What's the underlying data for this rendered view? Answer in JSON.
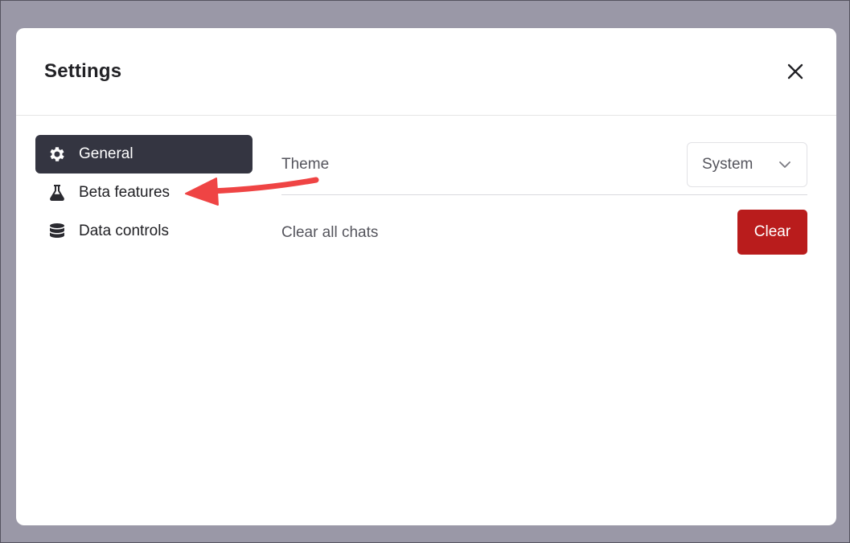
{
  "dialog": {
    "title": "Settings",
    "close_icon": "close-icon"
  },
  "nav": {
    "items": [
      {
        "label": "General",
        "icon": "gear-icon",
        "active": true
      },
      {
        "label": "Beta features",
        "icon": "flask-icon",
        "active": false
      },
      {
        "label": "Data controls",
        "icon": "database-icon",
        "active": false
      }
    ]
  },
  "settings": {
    "theme": {
      "label": "Theme",
      "value": "System",
      "icon": "chevron-down-icon"
    },
    "clear_chats": {
      "label": "Clear all chats",
      "button_label": "Clear"
    }
  },
  "colors": {
    "backdrop": "#9a98a7",
    "active_nav": "#343541",
    "danger": "#b91c1c",
    "annotation": "#ef4444"
  }
}
